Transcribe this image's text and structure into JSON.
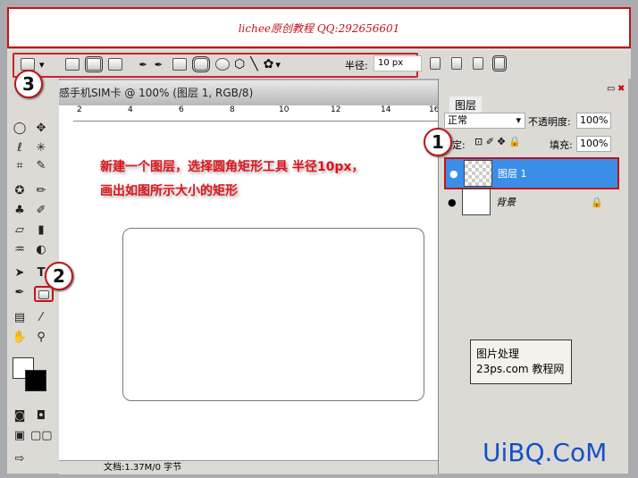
{
  "banner": {
    "text": "lichee原创教程 QQ:292656601"
  },
  "options": {
    "radius_label": "半径:",
    "radius_value": "10 px"
  },
  "document": {
    "title": "感手机SIM卡 @ 100% (图层 1, RGB/8)",
    "ruler_ticks": [
      "2",
      "4",
      "6",
      "8",
      "10",
      "12",
      "14",
      "16"
    ],
    "status": "文档:1.37M/0 字节"
  },
  "instructions": {
    "line1": "新建一个图层，选择圆角矩形工具 半径10px，",
    "line2": "画出如图所示大小的矩形"
  },
  "layers_panel": {
    "tab": "图层",
    "blend_mode": "正常",
    "opacity_label": "不透明度:",
    "opacity": "100%",
    "lock_label": "锁定:",
    "fill_label": "填充:",
    "fill": "100%",
    "layers": [
      {
        "name": "图层 1",
        "selected": true,
        "visible": true
      },
      {
        "name": "背景",
        "selected": false,
        "visible": true,
        "locked": true
      }
    ]
  },
  "annotations": [
    "1",
    "2",
    "3"
  ],
  "logo": {
    "line1": "图片处理",
    "line2": "23ps.com 教程网"
  },
  "watermark": "UiBQ.CoM",
  "colors": {
    "accent_red": "#c0141a",
    "selection_blue": "#3b8ee8"
  }
}
